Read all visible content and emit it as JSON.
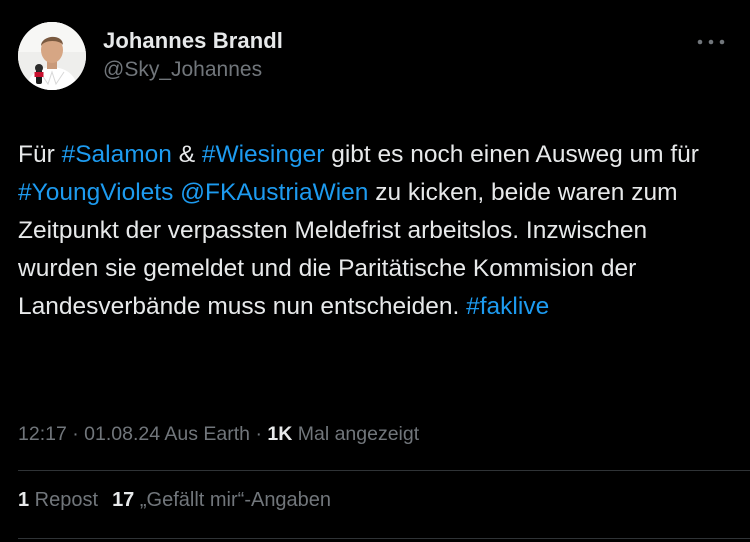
{
  "author": {
    "name": "Johannes Brandl",
    "handle": "@Sky_Johannes"
  },
  "tweet": {
    "segments": [
      {
        "text": "Für ",
        "link": false
      },
      {
        "text": "#Salamon",
        "link": true
      },
      {
        "text": " & ",
        "link": false
      },
      {
        "text": "#Wiesinger",
        "link": true
      },
      {
        "text": " gibt es noch einen Ausweg um für ",
        "link": false
      },
      {
        "text": "#YoungViolets",
        "link": true
      },
      {
        "text": " ",
        "link": false
      },
      {
        "text": "@FKAustriaWien",
        "link": true
      },
      {
        "text": " zu kicken, beide waren zum Zeitpunkt der verpassten Meldefrist arbeitslos. Inzwischen wurden sie gemeldet und die Paritätische Kommision der Landesverbände muss nun entscheiden. ",
        "link": false
      },
      {
        "text": "#faklive",
        "link": true
      }
    ]
  },
  "meta": {
    "time": "12:17",
    "sep1": " · ",
    "date": "01.08.24",
    "location": " Aus Earth",
    "sep2": " · ",
    "views_count": "1K",
    "views_label": " Mal angezeigt"
  },
  "stats": {
    "reposts_count": "1",
    "reposts_label": " Repost",
    "likes_count": "17",
    "likes_label": " „Gefällt mir“-Angaben"
  },
  "icons": {
    "more": "more-horizontal-icon"
  },
  "colors": {
    "background": "#000000",
    "text": "#e7e9ea",
    "secondary": "#71767b",
    "link": "#1d9bf0",
    "divider": "#2f3336"
  }
}
